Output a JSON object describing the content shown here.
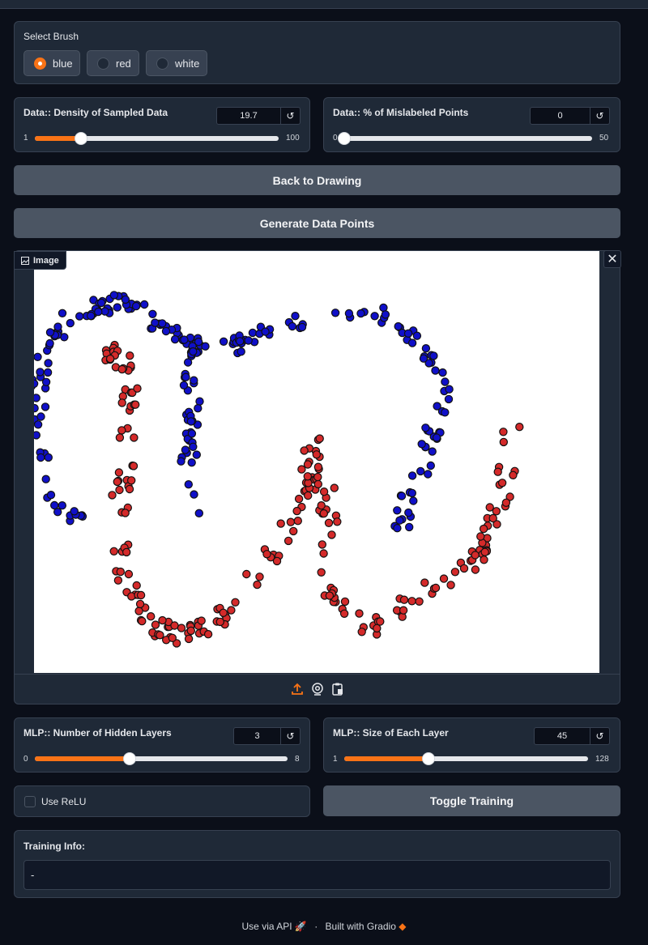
{
  "brush": {
    "label": "Select Brush",
    "options": [
      "blue",
      "red",
      "white"
    ],
    "selected": "blue"
  },
  "density": {
    "label": "Data:: Density of Sampled Data",
    "value": "19.7",
    "min": "1",
    "max": "100",
    "fraction": 0.189
  },
  "mislabeled": {
    "label": "Data:: % of Mislabeled Points",
    "value": "0",
    "min": "0",
    "max": "50",
    "fraction": 0.0
  },
  "buttons": {
    "back": "Back to Drawing",
    "generate": "Generate Data Points",
    "toggle": "Toggle Training"
  },
  "image": {
    "tag": "Image"
  },
  "layers": {
    "label": "MLP:: Number of Hidden Layers",
    "value": "3",
    "min": "0",
    "max": "8",
    "fraction": 0.375
  },
  "layer_size": {
    "label": "MLP:: Size of Each Layer",
    "value": "45",
    "min": "1",
    "max": "128",
    "fraction": 0.346
  },
  "relu": {
    "label": "Use ReLU",
    "checked": false
  },
  "training": {
    "label": "Training Info:",
    "value": "-"
  },
  "footer": {
    "api": "Use via API",
    "sep": "·",
    "built": "Built with Gradio"
  },
  "colors": {
    "accent": "#f97316",
    "blue_point": "#1010c8",
    "red_point": "#d42a2a"
  },
  "icons": [
    "upload-icon",
    "webcam-icon",
    "clipboard-icon",
    "image-icon",
    "close-icon",
    "reset-icon",
    "rocket-icon",
    "gradio-logo-icon"
  ]
}
